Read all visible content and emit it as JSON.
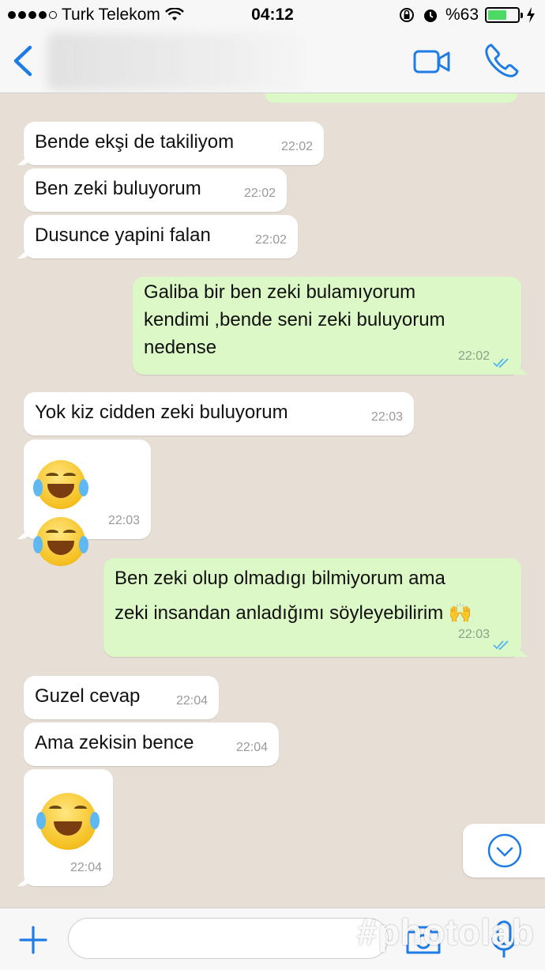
{
  "status_bar": {
    "carrier": "Turk Telekom",
    "time": "04:12",
    "battery_label": "%63",
    "battery_level": 0.63
  },
  "colors": {
    "accent": "#1f7ce5",
    "outgoing_bubble": "#dcf8c6",
    "incoming_bubble": "#ffffff",
    "read_ticks": "#4fb6ec",
    "chat_background": "#e7dfd5"
  },
  "nav": {
    "back_icon": "chevron-left-icon",
    "video_icon": "video-camera-icon",
    "call_icon": "phone-icon"
  },
  "messages": [
    {
      "direction": "in",
      "text": "Bende ekşi de takiliyom",
      "time": "22:02"
    },
    {
      "direction": "in",
      "text": "Ben zeki buluyorum",
      "time": "22:02"
    },
    {
      "direction": "in",
      "text": "Dusunce yapini falan",
      "time": "22:02"
    },
    {
      "direction": "out",
      "text_lines": [
        "Galiba bir ben zeki bulamıyorum",
        "kendimi ,bende seni zeki buluyorum",
        "nedense"
      ],
      "time": "22:02",
      "read": true
    },
    {
      "direction": "in",
      "text": "Yok kiz cidden zeki buluyorum",
      "time": "22:03"
    },
    {
      "direction": "in",
      "emoji": [
        "face-with-tears-of-joy",
        "face-with-tears-of-joy"
      ],
      "emoji_chars": "😂😂",
      "time": "22:03"
    },
    {
      "direction": "out",
      "text_lines": [
        "Ben zeki olup olmadıgı bilmiyorum ama",
        "zeki insandan anladığımı söyleyebilirim 🙌"
      ],
      "time": "22:03",
      "read": true
    },
    {
      "direction": "in",
      "text": "Guzel cevap",
      "time": "22:04"
    },
    {
      "direction": "in",
      "text": "Ama zekisin bence",
      "time": "22:04"
    },
    {
      "direction": "in",
      "emoji": [
        "face-with-tears-of-joy"
      ],
      "emoji_chars": "😂",
      "time": "22:04"
    }
  ],
  "composer": {
    "plus_icon": "plus-icon",
    "camera_icon": "camera-icon",
    "mic_icon": "microphone-icon",
    "value": ""
  },
  "scroll_down_icon": "chevron-down-circle-icon",
  "watermark": "#photolab"
}
